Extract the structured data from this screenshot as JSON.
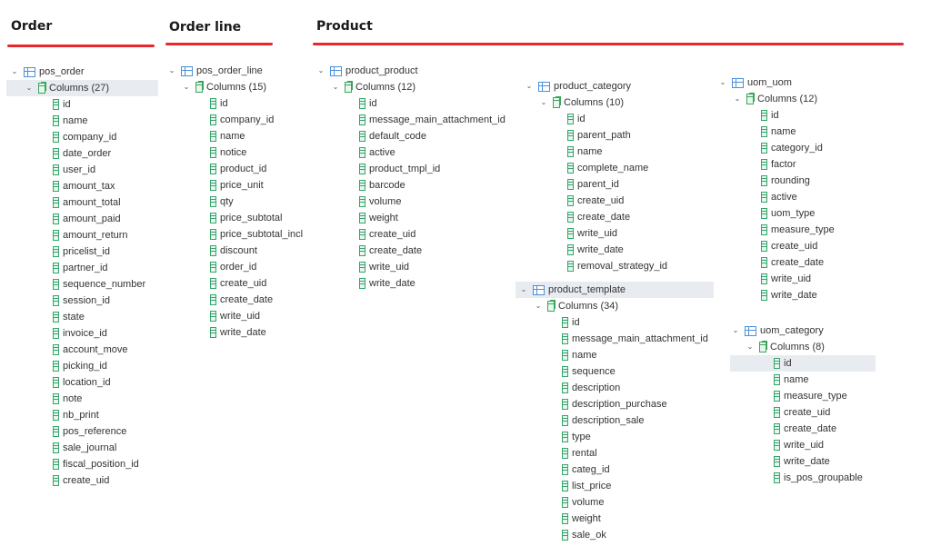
{
  "headings": {
    "order": "Order",
    "order_line": "Order line",
    "product": "Product"
  },
  "trees": [
    {
      "id": "pos_order",
      "name": "pos_order",
      "columns_label": "Columns (27)",
      "highlight_columns": true,
      "columns": [
        "id",
        "name",
        "company_id",
        "date_order",
        "user_id",
        "amount_tax",
        "amount_total",
        "amount_paid",
        "amount_return",
        "pricelist_id",
        "partner_id",
        "sequence_number",
        "session_id",
        "state",
        "invoice_id",
        "account_move",
        "picking_id",
        "location_id",
        "note",
        "nb_print",
        "pos_reference",
        "sale_journal",
        "fiscal_position_id",
        "create_uid"
      ]
    },
    {
      "id": "pos_order_line",
      "name": "pos_order_line",
      "columns_label": "Columns (15)",
      "columns": [
        "id",
        "company_id",
        "name",
        "notice",
        "product_id",
        "price_unit",
        "qty",
        "price_subtotal",
        "price_subtotal_incl",
        "discount",
        "order_id",
        "create_uid",
        "create_date",
        "write_uid",
        "write_date"
      ]
    },
    {
      "id": "product_product",
      "name": "product_product",
      "columns_label": "Columns (12)",
      "columns": [
        "id",
        "message_main_attachment_id",
        "default_code",
        "active",
        "product_tmpl_id",
        "barcode",
        "volume",
        "weight",
        "create_uid",
        "create_date",
        "write_uid",
        "write_date"
      ]
    },
    {
      "id": "product_category",
      "name": "product_category",
      "columns_label": "Columns (10)",
      "columns": [
        "id",
        "parent_path",
        "name",
        "complete_name",
        "parent_id",
        "create_uid",
        "create_date",
        "write_uid",
        "write_date",
        "removal_strategy_id"
      ]
    },
    {
      "id": "product_template",
      "name": "product_template",
      "columns_label": "Columns (34)",
      "highlight_table": true,
      "columns": [
        "id",
        "message_main_attachment_id",
        "name",
        "sequence",
        "description",
        "description_purchase",
        "description_sale",
        "type",
        "rental",
        "categ_id",
        "list_price",
        "volume",
        "weight",
        "sale_ok"
      ]
    },
    {
      "id": "uom_uom",
      "name": "uom_uom",
      "columns_label": "Columns (12)",
      "columns": [
        "id",
        "name",
        "category_id",
        "factor",
        "rounding",
        "active",
        "uom_type",
        "measure_type",
        "create_uid",
        "create_date",
        "write_uid",
        "write_date"
      ]
    },
    {
      "id": "uom_category",
      "name": "uom_category",
      "columns_label": "Columns (8)",
      "highlight_first_column": true,
      "columns": [
        "id",
        "name",
        "measure_type",
        "create_uid",
        "create_date",
        "write_uid",
        "write_date",
        "is_pos_groupable"
      ]
    }
  ]
}
